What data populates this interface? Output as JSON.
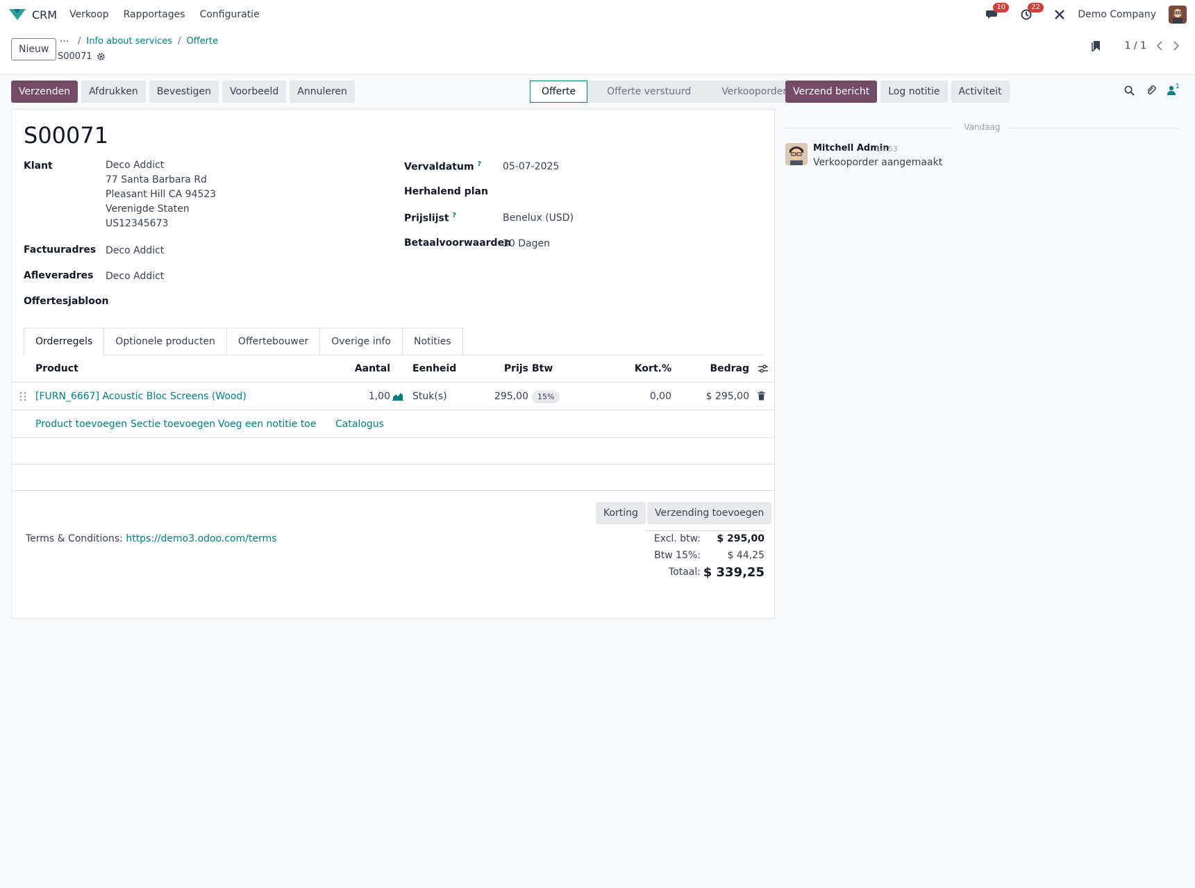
{
  "navbar": {
    "app_name": "CRM",
    "menu": [
      "Verkoop",
      "Rapportages",
      "Configuratie"
    ],
    "messages_count": "10",
    "activities_count": "22",
    "company": "Demo Company"
  },
  "control": {
    "new_label": "Nieuw",
    "breadcrumb_more": "···",
    "breadcrumb": [
      "Info about services",
      "Offerte"
    ],
    "record_name": "S00071",
    "pager": "1 / 1"
  },
  "actions": [
    "Verzenden",
    "Afdrukken",
    "Bevestigen",
    "Voorbeeld",
    "Annuleren"
  ],
  "status": {
    "stages": [
      "Offerte",
      "Offerte verstuurd",
      "Verkooporder"
    ],
    "active": "Offerte"
  },
  "chatter": {
    "buttons": [
      "Verzend bericht",
      "Log notitie",
      "Activiteit"
    ],
    "followers_count": "1",
    "date_separator": "Vandaag",
    "message": {
      "author": "Mitchell Admin",
      "time": "14:53",
      "body": "Verkooporder aangemaakt"
    }
  },
  "form": {
    "title": "S00071",
    "customer_label": "Klant",
    "customer_lines": [
      "Deco Addict",
      "77 Santa Barbara Rd",
      "Pleasant Hill CA 94523",
      "Verenigde Staten",
      "US12345673"
    ],
    "invoice_label": "Factuuradres",
    "invoice_value": "Deco Addict",
    "delivery_label": "Afleveradres",
    "delivery_value": "Deco Addict",
    "template_label": "Offertesjabloon",
    "expiry_label": "Vervaldatum",
    "expiry_value": "05-07-2025",
    "recurring_label": "Herhalend plan",
    "pricelist_label": "Prijslijst",
    "pricelist_value": "Benelux (USD)",
    "terms_label": "Betaalvoorwaarden",
    "terms_value": "30 Dagen",
    "help_mark": "?"
  },
  "tabs": [
    "Orderregels",
    "Optionele producten",
    "Offertebouwer",
    "Overige info",
    "Notities"
  ],
  "table": {
    "headers": {
      "product": "Product",
      "qty": "Aantal",
      "uom": "Eenheid",
      "price": "Prijs",
      "tax": "Btw",
      "discount": "Kort.%",
      "amount": "Bedrag"
    },
    "rows": [
      {
        "product": "[FURN_6667] Acoustic Bloc Screens (Wood)",
        "qty": "1,00",
        "uom": "Stuk(s)",
        "price": "295,00",
        "tax": "15%",
        "discount": "0,00",
        "amount": "$ 295,00"
      }
    ],
    "add_links": [
      "Product toevoegen",
      "Sectie toevoegen",
      "Voeg een notitie toe",
      "Catalogus"
    ]
  },
  "footer": {
    "terms_label": "Terms & Conditions:",
    "terms_link": "https://demo3.odoo.com/terms",
    "discount_button": "Korting",
    "shipping_button": "Verzending toevoegen",
    "untaxed_label": "Excl. btw:",
    "untaxed_value": "$ 295,00",
    "tax_label": "Btw 15%:",
    "tax_value": "$ 44,25",
    "total_label": "Totaal:",
    "total_value": "$ 339,25"
  },
  "colors": {
    "primary": "#714b67",
    "link": "#017e84",
    "badge": "#d23f3a"
  }
}
